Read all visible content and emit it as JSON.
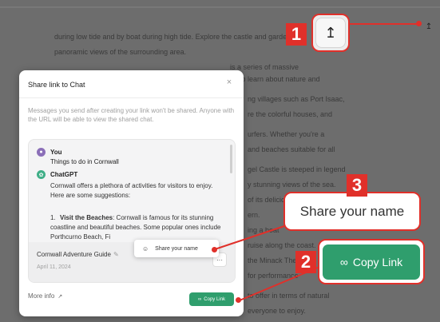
{
  "background": {
    "text_lines": [
      "during low tide and by boat during high tide. Explore the castle and gardens",
      "panoramic views of the surrounding area.",
      "is a series of massive",
      "ce to learn about nature and",
      "ng villages such as Port Isaac,",
      "re the colorful houses, and",
      "urfers. Whether you're a",
      "and beaches suitable for all",
      "gel Castle is steeped in legend",
      "y stunning views of the sea.",
      "of its delicious",
      "ern.",
      "ing a boat",
      "ruise along the coast.",
      "the Minack Theatre is a",
      "for performance",
      "to offer in terms of natural",
      "everyone to enjoy."
    ]
  },
  "modal": {
    "title": "Share link to Chat",
    "close_label": "×",
    "description": "Messages you send after creating your link won't be shared. Anyone with the URL will be able to view the shared chat.",
    "preview": {
      "user_name": "You",
      "user_message": "Things to do in Cornwall",
      "gpt_name": "ChatGPT",
      "gpt_message": "Cornwall offers a plethora of activities for visitors to enjoy. Here are some suggestions:",
      "list_item_number": "1.",
      "list_item_title": "Visit the Beaches",
      "list_item_text": ": Cornwall is famous for its stunning coastline and beautiful beaches. Some popular ones include Porthcurno Beach, Fi",
      "chat_title": "Cornwall Adventure Guide",
      "chat_date": "April 11, 2024",
      "more_label": "···",
      "popup_label": "Share your name"
    },
    "more_info_label": "More info",
    "copy_link_label": "Copy Link"
  },
  "annotations": {
    "badge_1": "1",
    "badge_2": "2",
    "badge_3": "3",
    "share_your_name": "Share your name",
    "copy_link": "Copy Link"
  },
  "colors": {
    "accent_red": "#e0302a",
    "green": "#2f9e6d"
  },
  "icons": {
    "upload": "upload-icon",
    "link": "link-icon",
    "person": "person-icon",
    "edit": "pencil-icon",
    "external": "external-link-icon",
    "close": "close-icon"
  }
}
